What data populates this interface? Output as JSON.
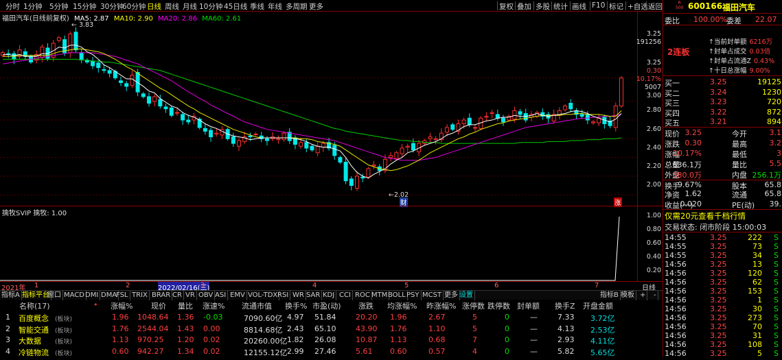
{
  "toolbar": {
    "periods": [
      "分时",
      "1分钟",
      "5分钟",
      "15分钟",
      "30分钟",
      "60分钟",
      "日线",
      "周线",
      "月线",
      "10分钟",
      "45日线",
      "季线",
      "年线",
      "多周期",
      "更多"
    ],
    "active_period": "日线",
    "right_buttons": [
      "复权",
      "叠加",
      "多股",
      "统计",
      "画线",
      "F10",
      "标记",
      "+自选",
      "返回"
    ]
  },
  "main": {
    "legend": {
      "name": "福田汽车(日线前复权)",
      "ma5": "MA5: 2.87",
      "ma10": "MA10: 2.90",
      "ma20": "MA20: 2.86",
      "ma60": "MA60: 2.61"
    },
    "high_label": "3.83",
    "low_label": "2.02",
    "cai_label": "财",
    "zhang_label": "涨",
    "axis": [
      {
        "v": "3.25",
        "cls": "white"
      },
      {
        "v": "191256",
        "cls": "white"
      },
      {
        "v": "3.25",
        "cls": "white"
      },
      {
        "v": "0.30",
        "cls": "red"
      },
      {
        "v": "10.17%",
        "cls": "red"
      },
      {
        "v": "5007",
        "cls": "white"
      },
      {
        "v": "3.00",
        "cls": "white"
      },
      {
        "v": "2.80",
        "cls": "white"
      },
      {
        "v": "2.60",
        "cls": "white"
      },
      {
        "v": "2.40",
        "cls": "white"
      },
      {
        "v": "2.20",
        "cls": "white"
      },
      {
        "v": "2.00",
        "cls": "white"
      }
    ],
    "close_prices": [
      3.52,
      3.5,
      3.45,
      3.55,
      3.48,
      3.42,
      3.5,
      3.58,
      3.46,
      3.62,
      3.68,
      3.52,
      3.72,
      3.55,
      3.45,
      3.42,
      3.38,
      3.36,
      3.33,
      3.3,
      3.25,
      3.2,
      3.16,
      3.28,
      3.1,
      3.05,
      2.98,
      3.05,
      2.95,
      2.92,
      2.85,
      2.88,
      2.8,
      2.78,
      2.84,
      2.72,
      2.68,
      2.62,
      2.66,
      2.7,
      2.6,
      2.55,
      2.58,
      2.62,
      2.62,
      2.65,
      2.6,
      2.58,
      2.62,
      2.6,
      2.66,
      2.58,
      2.54,
      2.56,
      2.5,
      2.48,
      2.52,
      2.55,
      2.5,
      2.42,
      2.35,
      2.15,
      2.1,
      2.2,
      2.18,
      2.28,
      2.32,
      2.26,
      2.38,
      2.42,
      2.45,
      2.5,
      2.52,
      2.48,
      2.55,
      2.58,
      2.62,
      2.6,
      2.66,
      2.72,
      2.7,
      2.76,
      2.8,
      2.75,
      2.72,
      2.82,
      2.84,
      2.88,
      2.82,
      2.78,
      2.84,
      2.9,
      2.86,
      2.8,
      2.86,
      2.88,
      2.84,
      2.82,
      2.86,
      2.9,
      2.95,
      2.92,
      2.86,
      2.84,
      2.8,
      2.78,
      2.82,
      2.76,
      2.74,
      2.95,
      3.25
    ],
    "ma5": [
      3.5,
      3.5,
      3.49,
      3.5,
      3.48,
      3.48,
      3.48,
      3.51,
      3.51,
      3.54,
      3.58,
      3.57,
      3.6,
      3.6,
      3.58,
      3.53,
      3.5,
      3.45,
      3.39,
      3.36,
      3.32,
      3.28,
      3.24,
      3.24,
      3.2,
      3.16,
      3.11,
      3.09,
      3.03,
      2.99,
      2.95,
      2.93,
      2.88,
      2.85,
      2.83,
      2.8,
      2.76,
      2.73,
      2.71,
      2.68,
      2.65,
      2.63,
      2.62,
      2.61,
      2.59,
      2.6,
      2.61,
      2.61,
      2.61,
      2.61,
      2.61,
      2.61,
      2.6,
      2.59,
      2.57,
      2.54,
      2.52,
      2.51,
      2.51,
      2.49,
      2.47,
      2.4,
      2.31,
      2.24,
      2.2,
      2.18,
      2.22,
      2.25,
      2.28,
      2.33,
      2.37,
      2.4,
      2.45,
      2.47,
      2.5,
      2.53,
      2.55,
      2.57,
      2.6,
      2.64,
      2.66,
      2.69,
      2.73,
      2.75,
      2.75,
      2.77,
      2.79,
      2.8,
      2.82,
      2.83,
      2.83,
      2.85,
      2.84,
      2.84,
      2.85,
      2.87,
      2.85,
      2.84,
      2.85,
      2.86,
      2.87,
      2.89,
      2.9,
      2.89,
      2.87,
      2.84,
      2.82,
      2.8,
      2.78,
      2.81,
      2.87
    ],
    "ma10": [
      3.48,
      3.48,
      3.48,
      3.49,
      3.49,
      3.49,
      3.49,
      3.49,
      3.49,
      3.51,
      3.53,
      3.54,
      3.55,
      3.56,
      3.56,
      3.55,
      3.54,
      3.53,
      3.51,
      3.48,
      3.45,
      3.41,
      3.37,
      3.34,
      3.3,
      3.26,
      3.22,
      3.18,
      3.14,
      3.11,
      3.07,
      3.03,
      2.99,
      2.95,
      2.92,
      2.88,
      2.85,
      2.82,
      2.79,
      2.76,
      2.73,
      2.7,
      2.68,
      2.66,
      2.64,
      2.62,
      2.61,
      2.61,
      2.61,
      2.61,
      2.61,
      2.61,
      2.61,
      2.6,
      2.6,
      2.59,
      2.57,
      2.56,
      2.55,
      2.54,
      2.52,
      2.48,
      2.44,
      2.4,
      2.36,
      2.32,
      2.3,
      2.28,
      2.27,
      2.26,
      2.27,
      2.29,
      2.31,
      2.34,
      2.37,
      2.41,
      2.45,
      2.48,
      2.51,
      2.54,
      2.57,
      2.6,
      2.62,
      2.65,
      2.67,
      2.7,
      2.72,
      2.74,
      2.76,
      2.77,
      2.79,
      2.8,
      2.81,
      2.82,
      2.83,
      2.84,
      2.85,
      2.85,
      2.85,
      2.85,
      2.86,
      2.86,
      2.87,
      2.87,
      2.86,
      2.86,
      2.86,
      2.85,
      2.84,
      2.84,
      2.9
    ],
    "ma20": [
      3.4,
      3.41,
      3.42,
      3.43,
      3.44,
      3.45,
      3.46,
      3.47,
      3.48,
      3.49,
      3.5,
      3.51,
      3.52,
      3.52,
      3.52,
      3.52,
      3.52,
      3.51,
      3.5,
      3.49,
      3.48,
      3.46,
      3.44,
      3.42,
      3.4,
      3.37,
      3.34,
      3.31,
      3.28,
      3.25,
      3.22,
      3.18,
      3.14,
      3.1,
      3.07,
      3.03,
      3.0,
      2.96,
      2.93,
      2.9,
      2.87,
      2.84,
      2.81,
      2.78,
      2.76,
      2.74,
      2.72,
      2.7,
      2.69,
      2.68,
      2.67,
      2.66,
      2.65,
      2.64,
      2.63,
      2.62,
      2.61,
      2.6,
      2.59,
      2.58,
      2.56,
      2.54,
      2.52,
      2.5,
      2.48,
      2.46,
      2.44,
      2.42,
      2.4,
      2.39,
      2.38,
      2.37,
      2.37,
      2.37,
      2.37,
      2.38,
      2.39,
      2.4,
      2.42,
      2.44,
      2.46,
      2.48,
      2.5,
      2.52,
      2.54,
      2.56,
      2.58,
      2.6,
      2.62,
      2.64,
      2.66,
      2.68,
      2.7,
      2.72,
      2.73,
      2.74,
      2.75,
      2.76,
      2.77,
      2.78,
      2.79,
      2.8,
      2.81,
      2.82,
      2.82,
      2.83,
      2.83,
      2.84,
      2.84,
      2.85,
      2.86
    ],
    "ma60": [
      3.45,
      3.45,
      3.45,
      3.45,
      3.45,
      3.45,
      3.45,
      3.45,
      3.45,
      3.45,
      3.45,
      3.45,
      3.45,
      3.45,
      3.44,
      3.44,
      3.43,
      3.43,
      3.42,
      3.42,
      3.41,
      3.4,
      3.39,
      3.38,
      3.37,
      3.36,
      3.35,
      3.34,
      3.33,
      3.31,
      3.29,
      3.27,
      3.25,
      3.23,
      3.21,
      3.19,
      3.17,
      3.15,
      3.13,
      3.11,
      3.09,
      3.07,
      3.05,
      3.03,
      3.01,
      2.99,
      2.97,
      2.95,
      2.93,
      2.91,
      2.89,
      2.87,
      2.85,
      2.83,
      2.81,
      2.79,
      2.77,
      2.75,
      2.73,
      2.71,
      2.7,
      2.68,
      2.67,
      2.66,
      2.65,
      2.64,
      2.63,
      2.62,
      2.61,
      2.6,
      2.59,
      2.58,
      2.58,
      2.57,
      2.57,
      2.56,
      2.56,
      2.56,
      2.55,
      2.55,
      2.55,
      2.55,
      2.55,
      2.55,
      2.55,
      2.55,
      2.55,
      2.55,
      2.55,
      2.55,
      2.55,
      2.55,
      2.56,
      2.56,
      2.56,
      2.56,
      2.56,
      2.57,
      2.57,
      2.57,
      2.57,
      2.58,
      2.58,
      2.58,
      2.59,
      2.59,
      2.59,
      2.6,
      2.6,
      2.6,
      2.61
    ]
  },
  "sub": {
    "legend": "擒牧SVIP 擒牧: 1.00",
    "axis": [
      "1.00",
      "0.80",
      "0.60",
      "0.40",
      "0.20"
    ]
  },
  "timebar": {
    "items": [
      "2021年",
      "1",
      "2",
      "2022/02/16(三)",
      "3",
      "4",
      "5",
      "6",
      "7"
    ],
    "right": "日线"
  },
  "tabs": [
    "指标A",
    "指标平台",
    "窗口",
    "MACD",
    "DMI",
    "DMA",
    "FSL",
    "TRIX",
    "BRAR",
    "CR",
    "VR",
    "OBV",
    "ASI",
    "EMV",
    "VOL-TDX",
    "RSI",
    "WR",
    "SAR",
    "KDJ",
    "CCI",
    "ROC",
    "MTM",
    "BOLL",
    "PSY",
    "MCST",
    "更多",
    "设置"
  ],
  "tabs_right": [
    "指标B",
    "模板",
    "+",
    "-"
  ],
  "table": {
    "headers": [
      "",
      "名称(17)",
      "•",
      "涨幅%",
      "现价",
      "量比",
      "涨速%",
      "流通市值",
      "换手%",
      "市盈(动)",
      "涨跌",
      "均涨幅%",
      "昨涨幅%",
      "涨停数",
      "跌停数",
      "封单额",
      "换手Z",
      "开盘金额"
    ],
    "rows": [
      [
        "1",
        "百度概念",
        "(板块)",
        "1.96",
        "1048.64",
        "1.36",
        "-0.03",
        "7090.60亿",
        "4.97",
        "51.84",
        "20.20",
        "1.96",
        "2.67",
        "5",
        "0",
        "—",
        "7.33",
        "3.72亿"
      ],
      [
        "2",
        "智能交通",
        "(板块)",
        "1.76",
        "2544.04",
        "1.43",
        "0.00",
        "8814.68亿",
        "2.43",
        "65.10",
        "43.90",
        "1.76",
        "1.10",
        "5",
        "0",
        "—",
        "4.13",
        "2.53亿"
      ],
      [
        "3",
        "大数据",
        "(板块)",
        "1.13",
        "970.25",
        "1.20",
        "0.02",
        "20260.00亿",
        "1.82",
        "26.08",
        "10.87",
        "1.13",
        "0.68",
        "7",
        "0",
        "—",
        "2.93",
        "4.11亿"
      ],
      [
        "4",
        "冷链物流",
        "(板块)",
        "0.60",
        "942.27",
        "1.34",
        "0.02",
        "12155.12亿",
        "2.99",
        "27.46",
        "5.61",
        "0.60",
        "0.57",
        "4",
        "0",
        "—",
        "5.82",
        "5.65亿"
      ]
    ]
  },
  "right": {
    "code": "600166",
    "name": "福田汽车",
    "tag_top": "R",
    "tag_bottom": "500",
    "weibi_label": "委比",
    "weibi": "100.00%",
    "weicha_label": "委差",
    "weicha": "22.07",
    "board": "2连板",
    "info": [
      [
        "当前封单额",
        "6216万"
      ],
      [
        "封单占成交",
        "0.03倍"
      ],
      [
        "封单占流通Z",
        "0.43%"
      ],
      [
        "十日总涨幅",
        "9.00%"
      ]
    ],
    "buys": [
      [
        "买一",
        "3.25",
        "19125"
      ],
      [
        "买二",
        "3.24",
        "1230"
      ],
      [
        "买三",
        "3.23",
        "720"
      ],
      [
        "买四",
        "3.22",
        "872"
      ],
      [
        "买五",
        "3.21",
        "894"
      ]
    ],
    "stats": [
      [
        "现价",
        "3.25",
        "今开",
        "3.1"
      ],
      [
        "涨跌",
        "0.30",
        "最高",
        "3.2"
      ],
      [
        "涨幅",
        "10.17%",
        "最低",
        "3"
      ],
      [
        "总量",
        "636.1万",
        "量比",
        "5.5"
      ],
      [
        "外盘",
        "380.0万",
        "内盘",
        "256.1万"
      ],
      [
        "换手",
        "9.67%",
        "股本",
        "65.8"
      ],
      [
        "净资",
        "1.62",
        "流通",
        "65.8"
      ],
      [
        "收益(一)",
        "0.020",
        "PE(动)",
        "39."
      ]
    ],
    "ad": "仅需20元查看千档行情",
    "status": "交易状态: 闭市阶段 15:00:03",
    "ticks": [
      [
        "14:55",
        "3.25",
        "222",
        "S"
      ],
      [
        "14:55",
        "3.25",
        "73",
        "S"
      ],
      [
        "14:55",
        "3.25",
        "34",
        "S"
      ],
      [
        "14:56",
        "3.25",
        "13",
        "S"
      ],
      [
        "14:56",
        "3.25",
        "120",
        "S"
      ],
      [
        "14:56",
        "3.25",
        "62",
        "S"
      ],
      [
        "14:56",
        "3.25",
        "153",
        "S"
      ],
      [
        "14:56",
        "3.25",
        "1",
        "S"
      ],
      [
        "14:56",
        "3.25",
        "30",
        "S"
      ],
      [
        "14:56",
        "3.25",
        "273",
        "S"
      ],
      [
        "14:56",
        "3.25",
        "70",
        "S"
      ],
      [
        "14:56",
        "3.25",
        "31",
        "S"
      ],
      [
        "14:56",
        "3.25",
        "108",
        "S"
      ],
      [
        "14:56",
        "3.25",
        "5",
        "S"
      ]
    ]
  }
}
